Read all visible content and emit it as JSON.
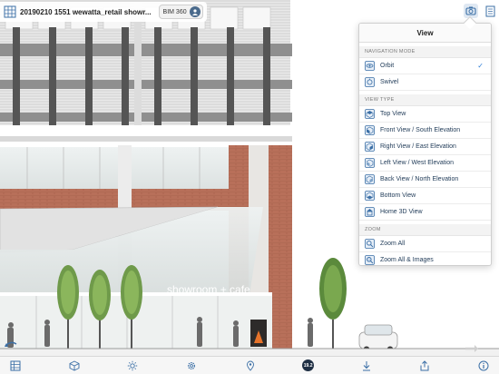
{
  "title_bar": {
    "document_title": "20190210 1551 wewatta_retail showr...",
    "hub_label": "BIM 360",
    "doc_icon": "grid-sheet-icon",
    "avatar_icon": "user-avatar-icon"
  },
  "top_right": {
    "view_button_icon": "camera-view-icon",
    "sheets_button_icon": "sheets-icon"
  },
  "scene": {
    "storefront_text": "showroom + cafe"
  },
  "view_panel": {
    "title": "View",
    "sections": {
      "navigation_mode": "NAVIGATION MODE",
      "view_type": "VIEW TYPE",
      "zoom": "ZOOM"
    },
    "navigation_items": [
      {
        "label": "Orbit",
        "icon": "orbit-icon",
        "selected": true
      },
      {
        "label": "Swivel",
        "icon": "swivel-icon",
        "selected": false
      }
    ],
    "view_type_items": [
      {
        "label": "Top View",
        "icon": "top-view-cube-icon"
      },
      {
        "label": "Front View / South Elevation",
        "icon": "front-view-cube-icon"
      },
      {
        "label": "Right View / East Elevation",
        "icon": "right-view-cube-icon"
      },
      {
        "label": "Left View / West Elevation",
        "icon": "left-view-cube-icon"
      },
      {
        "label": "Back View / North Elevation",
        "icon": "back-view-cube-icon"
      },
      {
        "label": "Bottom View",
        "icon": "bottom-view-cube-icon"
      },
      {
        "label": "Home 3D View",
        "icon": "home-3d-view-icon"
      }
    ],
    "zoom_items": [
      {
        "label": "Zoom All",
        "icon": "zoom-all-icon"
      },
      {
        "label": "Zoom All & Images",
        "icon": "zoom-all-images-icon"
      }
    ],
    "check_glyph": "✓"
  },
  "bottom_toolbar": {
    "buttons": [
      {
        "icon": "sheets-list-icon"
      },
      {
        "icon": "3d-cube-icon"
      },
      {
        "icon": "sun-settings-icon"
      },
      {
        "icon": "gear-icon"
      },
      {
        "icon": "location-pin-icon"
      },
      {
        "icon": "version-badge-icon",
        "text": "19.2"
      },
      {
        "icon": "download-icon"
      },
      {
        "icon": "share-icon"
      },
      {
        "icon": "info-icon"
      }
    ]
  },
  "colors": {
    "accent": "#2f7fd8",
    "icon_blue": "#3b6fa6",
    "panel_text": "#1f3a57",
    "brick": "#b5654d"
  }
}
